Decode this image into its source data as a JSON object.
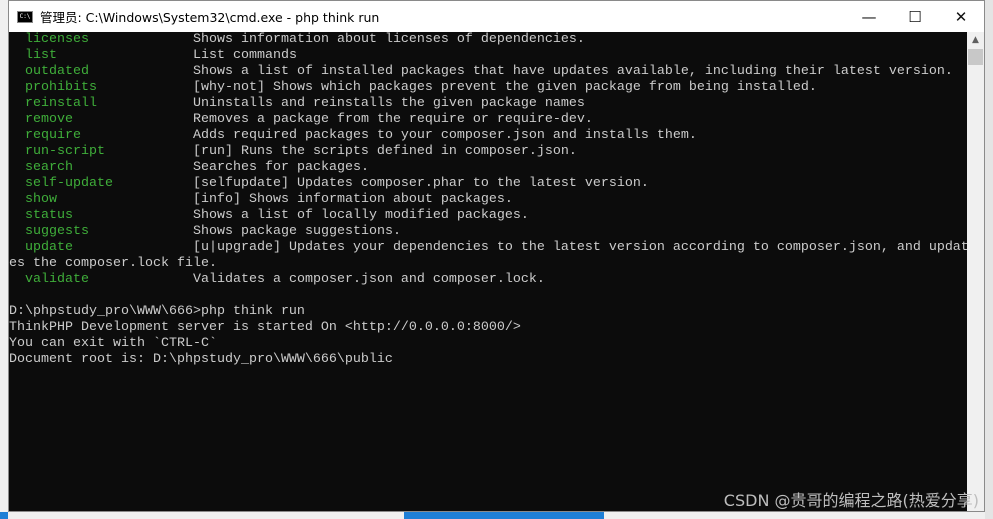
{
  "window": {
    "title": "管理员: C:\\Windows\\System32\\cmd.exe - php  think run",
    "icon": "cmd-icon",
    "controls": {
      "minimize": "—",
      "maximize": "☐",
      "close": "✕"
    }
  },
  "console": {
    "commands": [
      {
        "name": "licenses",
        "desc": "Shows information about licenses of dependencies."
      },
      {
        "name": "list",
        "desc": "List commands"
      },
      {
        "name": "outdated",
        "desc": "Shows a list of installed packages that have updates available, including their latest version."
      },
      {
        "name": "prohibits",
        "desc": "[why-not] Shows which packages prevent the given package from being installed."
      },
      {
        "name": "reinstall",
        "desc": "Uninstalls and reinstalls the given package names"
      },
      {
        "name": "remove",
        "desc": "Removes a package from the require or require-dev."
      },
      {
        "name": "require",
        "desc": "Adds required packages to your composer.json and installs them."
      },
      {
        "name": "run-script",
        "desc": "[run] Runs the scripts defined in composer.json."
      },
      {
        "name": "search",
        "desc": "Searches for packages."
      },
      {
        "name": "self-update",
        "desc": "[selfupdate] Updates composer.phar to the latest version."
      },
      {
        "name": "show",
        "desc": "[info] Shows information about packages."
      },
      {
        "name": "status",
        "desc": "Shows a list of locally modified packages."
      },
      {
        "name": "suggests",
        "desc": "Shows package suggestions."
      },
      {
        "name": "update",
        "desc": "[u|upgrade] Updates your dependencies to the latest version according to composer.json, and updat"
      }
    ],
    "wrap_line": "es the composer.lock file.",
    "last_command": {
      "name": "validate",
      "desc": "Validates a composer.json and composer.lock."
    },
    "output": [
      "D:\\phpstudy_pro\\WWW\\666>php think run",
      "ThinkPHP Development server is started On <http://0.0.0.0:8000/>",
      "You can exit with `CTRL-C`",
      "Document root is: D:\\phpstudy_pro\\WWW\\666\\public"
    ]
  },
  "watermark": "CSDN @贵哥的编程之路(热爱分享)"
}
